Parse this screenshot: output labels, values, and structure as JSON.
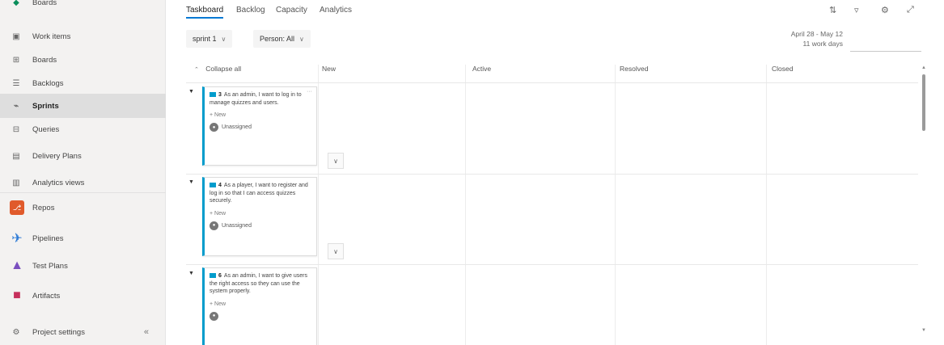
{
  "sidebar": {
    "top_partial": "Boards",
    "items": [
      {
        "label": "Work items",
        "icon": "work-items-icon"
      },
      {
        "label": "Boards",
        "icon": "boards-icon"
      },
      {
        "label": "Backlogs",
        "icon": "backlogs-icon"
      },
      {
        "label": "Sprints",
        "icon": "sprints-icon"
      },
      {
        "label": "Queries",
        "icon": "queries-icon"
      },
      {
        "label": "Delivery Plans",
        "icon": "delivery-plans-icon"
      },
      {
        "label": "Analytics views",
        "icon": "analytics-views-icon"
      }
    ],
    "services": [
      {
        "label": "Repos",
        "icon": "repos-icon",
        "color": "#e05a2b"
      },
      {
        "label": "Pipelines",
        "icon": "pipelines-icon",
        "color": "#2e7bd6"
      },
      {
        "label": "Test Plans",
        "icon": "test-plans-icon",
        "color": "#7a4fbf"
      },
      {
        "label": "Artifacts",
        "icon": "artifacts-icon",
        "color": "#c6305c"
      }
    ],
    "footer": {
      "label": "Project settings",
      "icon": "gear-icon"
    }
  },
  "tabs": [
    "Taskboard",
    "Backlog",
    "Capacity",
    "Analytics"
  ],
  "filters": {
    "sprint": "sprint 1",
    "person": "Person: All"
  },
  "daterange": {
    "dates": "April 28 - May 12",
    "workdays": "11 work days"
  },
  "board": {
    "collapse_label": "Collapse all",
    "columns": [
      "New",
      "Active",
      "Resolved",
      "Closed"
    ],
    "cards": [
      {
        "id": "3",
        "title": "As an admin, I want to log in to manage quizzes and users.",
        "new_label": "+ New",
        "assignee": "Unassigned"
      },
      {
        "id": "4",
        "title": "As a player, I want to register and log in so that I can access quizzes securely.",
        "new_label": "+ New",
        "assignee": "Unassigned"
      },
      {
        "id": "6",
        "title": "As an admin, I want to give users the right access so they can use the system properly.",
        "new_label": "+ New",
        "assignee": ""
      }
    ]
  },
  "colors": {
    "accent": "#0078d4",
    "card_border": "#009ccc"
  }
}
